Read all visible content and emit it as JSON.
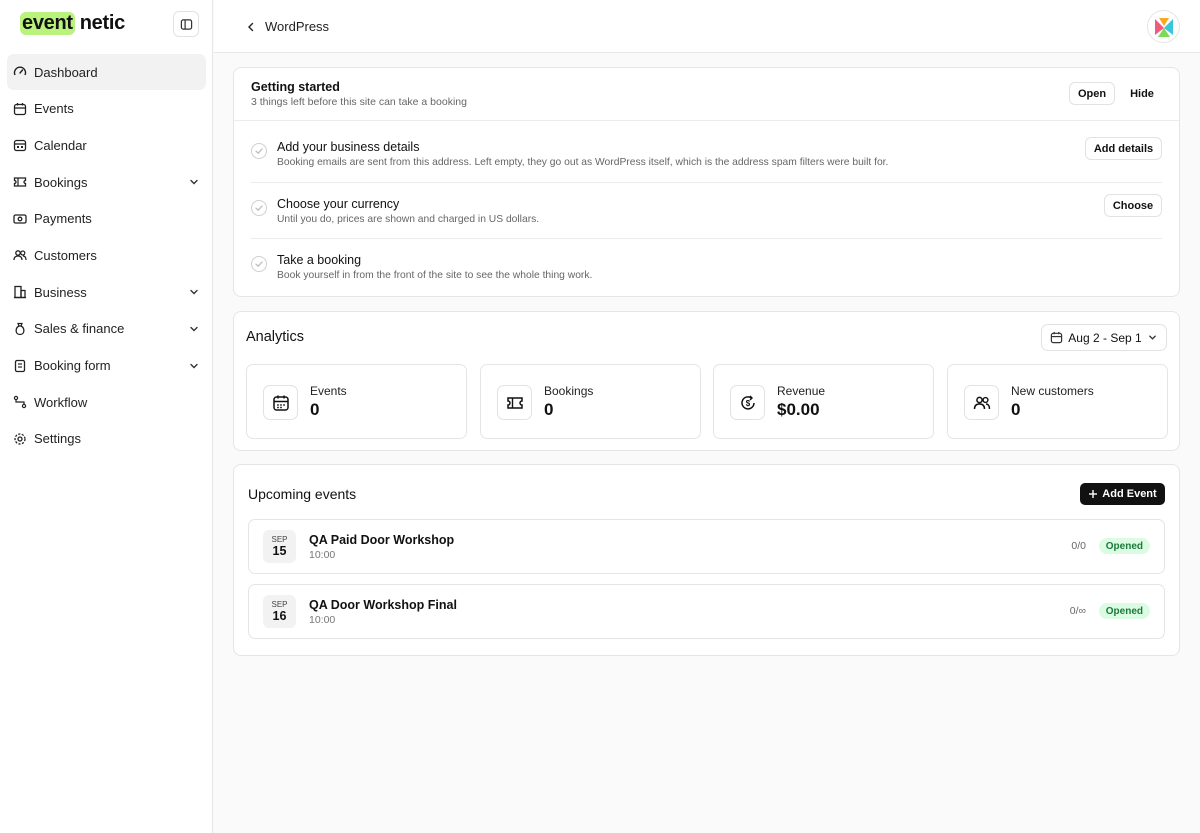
{
  "brand": {
    "highlight": "event",
    "rest": "netic"
  },
  "sidebar": {
    "items": [
      {
        "label": "Dashboard",
        "icon": "gauge-icon"
      },
      {
        "label": "Events",
        "icon": "calendar-icon"
      },
      {
        "label": "Calendar",
        "icon": "calendar-grid-icon"
      },
      {
        "label": "Bookings",
        "icon": "ticket-icon"
      },
      {
        "label": "Payments",
        "icon": "money-icon"
      },
      {
        "label": "Customers",
        "icon": "users-icon"
      },
      {
        "label": "Business",
        "icon": "building-icon"
      },
      {
        "label": "Sales & finance",
        "icon": "moneybag-icon"
      },
      {
        "label": "Booking form",
        "icon": "form-icon"
      },
      {
        "label": "Workflow",
        "icon": "workflow-icon"
      },
      {
        "label": "Settings",
        "icon": "gear-icon"
      }
    ]
  },
  "topbar": {
    "back_label": "WordPress"
  },
  "getting_started": {
    "title": "Getting started",
    "subtitle": "3 things left before this site can take a booking",
    "open_label": "Open",
    "hide_label": "Hide",
    "tasks": [
      {
        "title": "Add your business details",
        "desc": "Booking emails are sent from this address. Left empty, they go out as WordPress itself, which is the address spam filters were built for.",
        "action": "Add details"
      },
      {
        "title": "Choose your currency",
        "desc": "Until you do, prices are shown and charged in US dollars.",
        "action": "Choose"
      },
      {
        "title": "Take a booking",
        "desc": "Book yourself in from the front of the site to see the whole thing work."
      }
    ]
  },
  "analytics": {
    "title": "Analytics",
    "date_range": "Aug 2 - Sep 1",
    "stats": [
      {
        "label": "Events",
        "value": "0",
        "icon": "calendar-icon"
      },
      {
        "label": "Bookings",
        "value": "0",
        "icon": "ticket-icon"
      },
      {
        "label": "Revenue",
        "value": "$0.00",
        "icon": "dollar-refresh-icon"
      },
      {
        "label": "New customers",
        "value": "0",
        "icon": "users-icon"
      }
    ]
  },
  "upcoming": {
    "title": "Upcoming events",
    "add_label": "Add Event",
    "events": [
      {
        "month": "SEP",
        "day": "15",
        "title": "QA Paid Door Workshop",
        "time": "10:00",
        "capacity": "0/0",
        "status": "Opened"
      },
      {
        "month": "SEP",
        "day": "16",
        "title": "QA Door Workshop Final",
        "time": "10:00",
        "capacity": "0/∞",
        "status": "Opened"
      }
    ]
  },
  "colors": {
    "brand_highlight": "#b9f27c",
    "badge_bg": "#dcfbe3",
    "badge_text": "#1a7a3a",
    "primary_button": "#111111"
  }
}
